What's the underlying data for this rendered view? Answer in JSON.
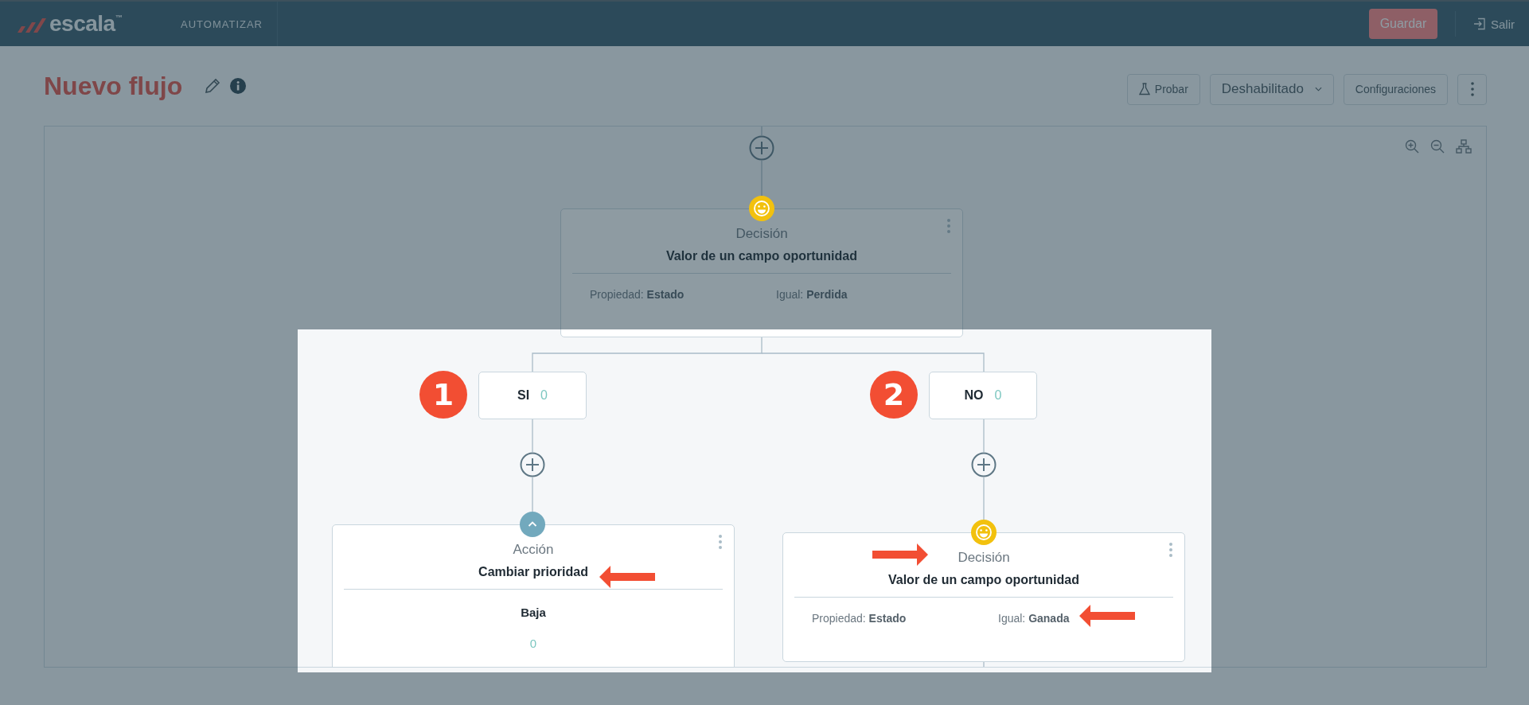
{
  "header": {
    "logo": "escala$^{™}$",
    "module": "AUTOMATIZAR",
    "save_button": "Guardar",
    "exit_link": "Salir"
  },
  "title": "Nuevo flujo",
  "toolbar": {
    "test_button": "Probar",
    "status_dropdown": "Deshabilitado",
    "settings_button": "Configuraciones"
  },
  "flow": {
    "root": {
      "kind": "decision",
      "type_label": "Decisión",
      "title": "Valor de un campo oportunidad",
      "conditions": [
        {
          "label": "Propiedad:",
          "value": "Estado"
        },
        {
          "label": "Igual:",
          "value": "Perdida"
        }
      ]
    },
    "branches": [
      {
        "label": "SI",
        "count": "0",
        "badge": "1",
        "node": {
          "kind": "action",
          "type_label": "Acción",
          "title": "Cambiar prioridad",
          "value": "Baja",
          "count": "0"
        }
      },
      {
        "label": "NO",
        "count": "0",
        "badge": "2",
        "node": {
          "kind": "decision",
          "type_label": "Decisión",
          "title": "Valor de un campo oportunidad",
          "conditions": [
            {
              "label": "Propiedad:",
              "value": "Estado"
            },
            {
              "label": "Igual:",
              "value": "Ganada"
            }
          ]
        }
      }
    ]
  }
}
